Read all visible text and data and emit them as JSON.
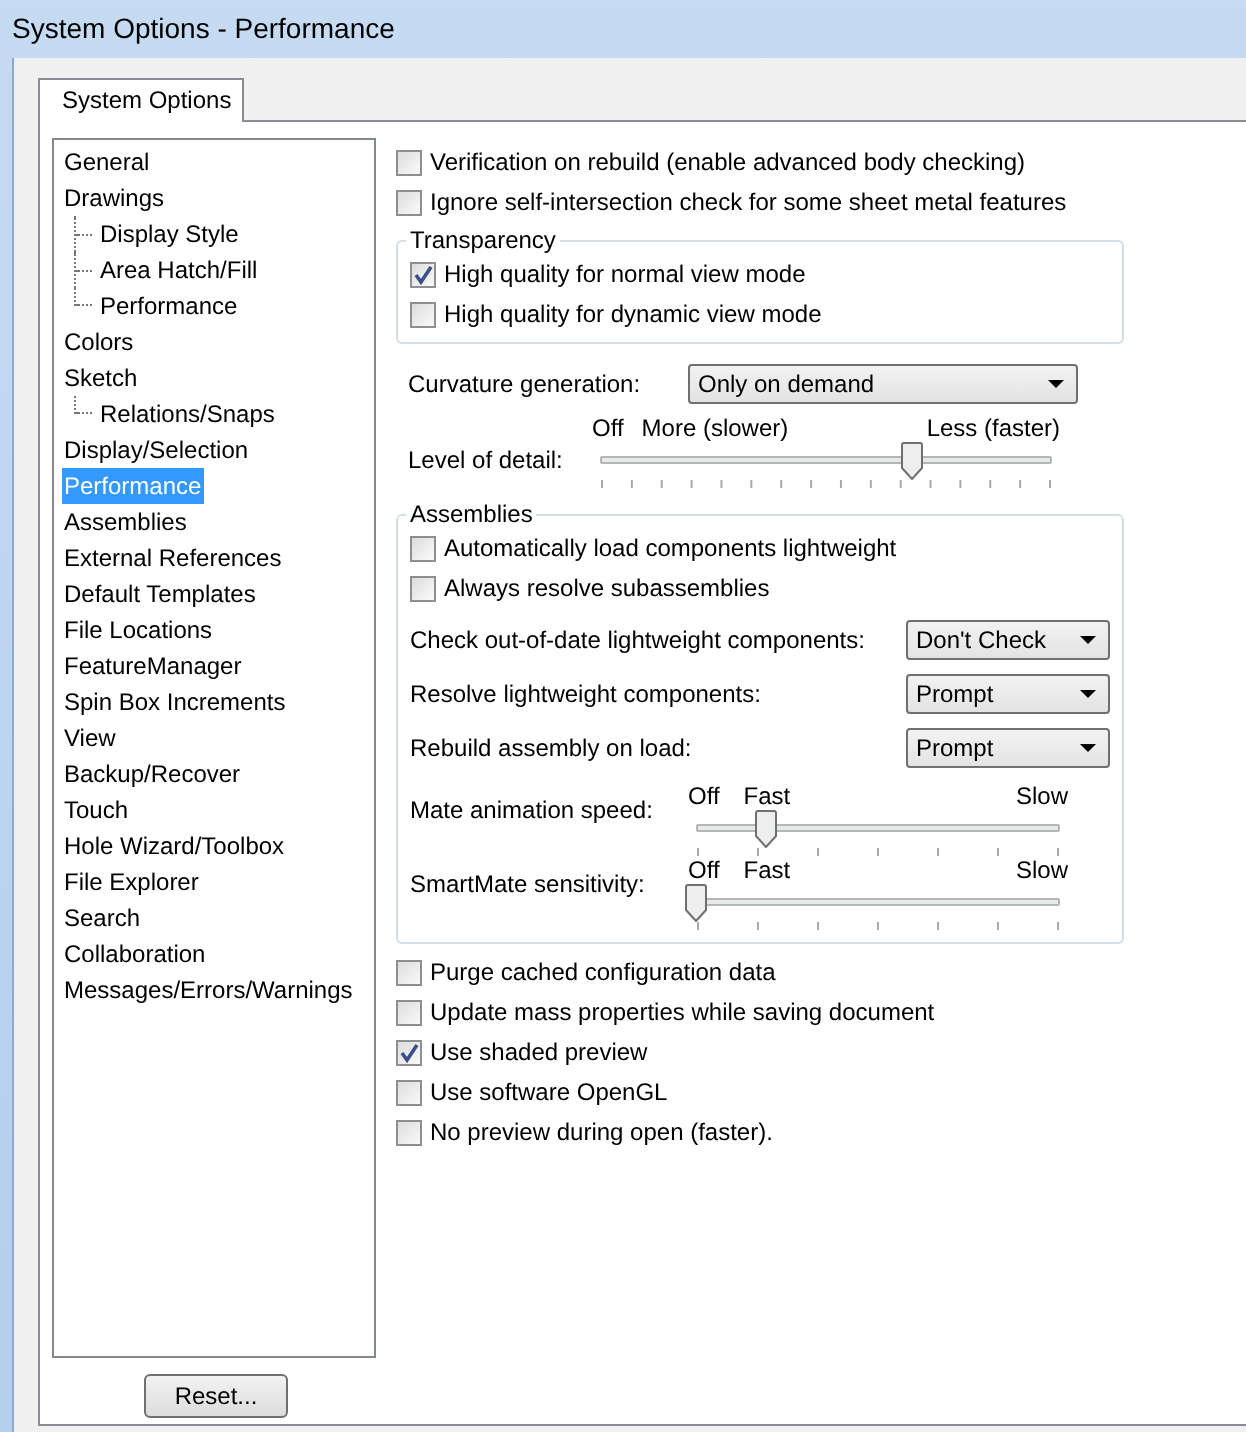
{
  "window": {
    "title": "System Options - Performance"
  },
  "tabs": [
    {
      "label": "System Options",
      "selected": true
    }
  ],
  "tree": [
    {
      "label": "General",
      "selected": false
    },
    {
      "label": "Drawings",
      "selected": false,
      "children": [
        {
          "label": "Display Style",
          "selected": false
        },
        {
          "label": "Area Hatch/Fill",
          "selected": false
        },
        {
          "label": "Performance",
          "selected": false
        }
      ]
    },
    {
      "label": "Colors",
      "selected": false
    },
    {
      "label": "Sketch",
      "selected": false,
      "children": [
        {
          "label": "Relations/Snaps",
          "selected": false
        }
      ]
    },
    {
      "label": "Display/Selection",
      "selected": false
    },
    {
      "label": "Performance",
      "selected": true
    },
    {
      "label": "Assemblies",
      "selected": false
    },
    {
      "label": "External References",
      "selected": false
    },
    {
      "label": "Default Templates",
      "selected": false
    },
    {
      "label": "File Locations",
      "selected": false
    },
    {
      "label": "FeatureManager",
      "selected": false
    },
    {
      "label": "Spin Box Increments",
      "selected": false
    },
    {
      "label": "View",
      "selected": false
    },
    {
      "label": "Backup/Recover",
      "selected": false
    },
    {
      "label": "Touch",
      "selected": false
    },
    {
      "label": "Hole Wizard/Toolbox",
      "selected": false
    },
    {
      "label": "File Explorer",
      "selected": false
    },
    {
      "label": "Search",
      "selected": false
    },
    {
      "label": "Collaboration",
      "selected": false
    },
    {
      "label": "Messages/Errors/Warnings",
      "selected": false
    }
  ],
  "top_options": [
    {
      "label": "Verification on rebuild (enable advanced body checking)",
      "checked": false
    },
    {
      "label": "Ignore self-intersection check for some sheet metal features",
      "checked": false
    }
  ],
  "transparency": {
    "title": "Transparency",
    "options": [
      {
        "label": "High quality for normal view mode",
        "checked": true
      },
      {
        "label": "High quality for dynamic view mode",
        "checked": false
      }
    ]
  },
  "curvature_generation": {
    "label": "Curvature generation:",
    "value": "Only on demand"
  },
  "level_of_detail": {
    "label": "Level of detail:",
    "scale_labels": [
      "Off",
      "More (slower)",
      "Less (faster)"
    ],
    "level": 0.69
  },
  "assemblies": {
    "title": "Assemblies",
    "options": [
      {
        "label": "Automatically load components lightweight",
        "checked": false
      },
      {
        "label": "Always resolve subassemblies",
        "checked": false
      }
    ],
    "dropdowns": [
      {
        "label": "Check out-of-date lightweight components:",
        "value": "Don't Check"
      },
      {
        "label": "Resolve lightweight components:",
        "value": "Prompt"
      },
      {
        "label": "Rebuild assembly on load:",
        "value": "Prompt"
      }
    ],
    "sliders": [
      {
        "label": "Mate animation speed:",
        "scale_labels": [
          "Off",
          "Fast",
          "Slow"
        ],
        "level": 0.19
      },
      {
        "label": "SmartMate sensitivity:",
        "scale_labels": [
          "Off",
          "Fast",
          "Slow"
        ],
        "level": 0.0
      }
    ]
  },
  "bottom_options": [
    {
      "label": "Purge cached configuration data",
      "checked": false
    },
    {
      "label": "Update mass properties while saving document",
      "checked": false
    },
    {
      "label": "Use shaded preview",
      "checked": true
    },
    {
      "label": "Use software OpenGL",
      "checked": false
    },
    {
      "label": "No preview during open (faster).",
      "checked": false
    }
  ],
  "reset_button": {
    "label": "Reset..."
  }
}
